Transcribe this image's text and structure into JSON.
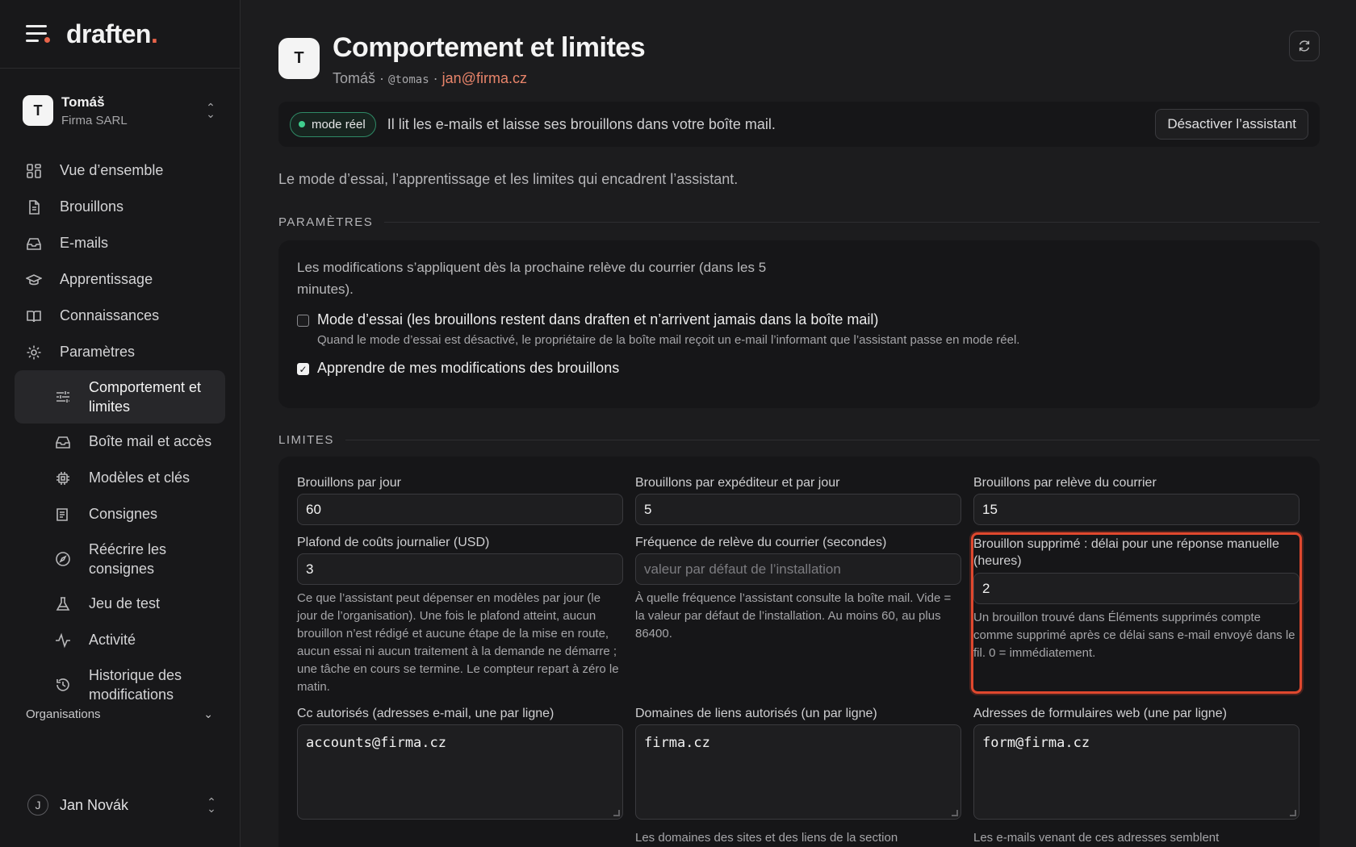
{
  "brand": {
    "name": "draften",
    "accent_char": "."
  },
  "sidebar": {
    "org": {
      "initial": "T",
      "name": "Tomáš",
      "subtitle": "Firma SARL"
    },
    "items": [
      {
        "label": "Vue d’ensemble",
        "icon": "grid-icon"
      },
      {
        "label": "Brouillons",
        "icon": "document-icon"
      },
      {
        "label": "E-mails",
        "icon": "inbox-icon"
      },
      {
        "label": "Apprentissage",
        "icon": "graduation-cap-icon"
      },
      {
        "label": "Connaissances",
        "icon": "book-icon"
      },
      {
        "label": "Paramètres",
        "icon": "gear-icon"
      }
    ],
    "subitems": [
      {
        "label": "Comportement et limites",
        "icon": "sliders-icon",
        "active": true
      },
      {
        "label": "Boîte mail et accès",
        "icon": "inbox-icon"
      },
      {
        "label": "Modèles et clés",
        "icon": "chip-icon"
      },
      {
        "label": "Consignes",
        "icon": "list-icon"
      },
      {
        "label": "Réécrire les consignes",
        "icon": "compass-icon"
      },
      {
        "label": "Jeu de test",
        "icon": "flask-icon"
      },
      {
        "label": "Activité",
        "icon": "activity-icon"
      },
      {
        "label": "Historique des modifications",
        "icon": "history-icon"
      }
    ],
    "organisations_label": "Organisations",
    "user": {
      "initial": "J",
      "name": "Jan Novák"
    }
  },
  "header": {
    "initial": "T",
    "title": "Comportement et limites",
    "user_name": "Tomáš",
    "sep": "·",
    "handle": "@tomas",
    "email": "jan@firma.cz"
  },
  "banner": {
    "pill": "mode réel",
    "text": "Il lit les e-mails et laisse ses brouillons dans votre boîte mail.",
    "button": "Désactiver l’assistant"
  },
  "intro": "Le mode d’essai, l’apprentissage et les limites qui encadrent l’assistant.",
  "settings": {
    "section": "PARAMÈTRES",
    "note": "Les modifications s’appliquent dès la prochaine relève du courrier (dans les 5 minutes).",
    "trial_mode": {
      "label": "Mode d’essai (les brouillons restent dans draften et n’arrivent jamais dans la boîte mail)",
      "hint": "Quand le mode d’essai est désactivé, le propriétaire de la boîte mail reçoit un e-mail l’informant que l’assistant passe en mode réel.",
      "checked": false
    },
    "learn": {
      "label": "Apprendre de mes modifications des brouillons",
      "checked": true
    }
  },
  "limits": {
    "section": "LIMITES",
    "drafts_per_day": {
      "label": "Brouillons par jour",
      "value": "60"
    },
    "drafts_per_sender": {
      "label": "Brouillons par expéditeur et par jour",
      "value": "5"
    },
    "drafts_per_fetch": {
      "label": "Brouillons par relève du courrier",
      "value": "15"
    },
    "daily_cost_cap": {
      "label": "Plafond de coûts journalier (USD)",
      "value": "3",
      "hint": "Ce que l’assistant peut dépenser en modèles par jour (le jour de l’organisation). Une fois le plafond atteint, aucun brouillon n’est rédigé et aucune étape de la mise en route, aucun essai ni aucun traitement à la demande ne démarre ; une tâche en cours se termine. Le compteur repart à zéro le matin."
    },
    "fetch_frequency": {
      "label": "Fréquence de relève du courrier (secondes)",
      "placeholder": "valeur par défaut de l’installation",
      "hint": "À quelle fréquence l’assistant consulte la boîte mail. Vide = la valeur par défaut de l’installation. Au moins 60, au plus 86400."
    },
    "deleted_draft_delay": {
      "label": "Brouillon supprimé : délai pour une réponse manuelle (heures)",
      "value": "2",
      "hint": "Un brouillon trouvé dans Éléments supprimés compte comme supprimé après ce délai sans e-mail envoyé dans le fil. 0 = immédiatement."
    },
    "allowed_cc": {
      "label": "Cc autorisés (adresses e-mail, une par ligne)",
      "value": "accounts@firma.cz"
    },
    "allowed_link_domains": {
      "label": "Domaines de liens autorisés (un par ligne)",
      "value": "firma.cz",
      "hint": "Les domaines des sites et des liens de la section"
    },
    "web_form_addresses": {
      "label": "Adresses de formulaires web (une par ligne)",
      "value": "form@firma.cz",
      "hint": "Les e-mails venant de ces adresses semblent"
    }
  },
  "colors": {
    "accent": "#e8644a",
    "live": "#3fcf8e",
    "highlight": "#e0482e"
  }
}
